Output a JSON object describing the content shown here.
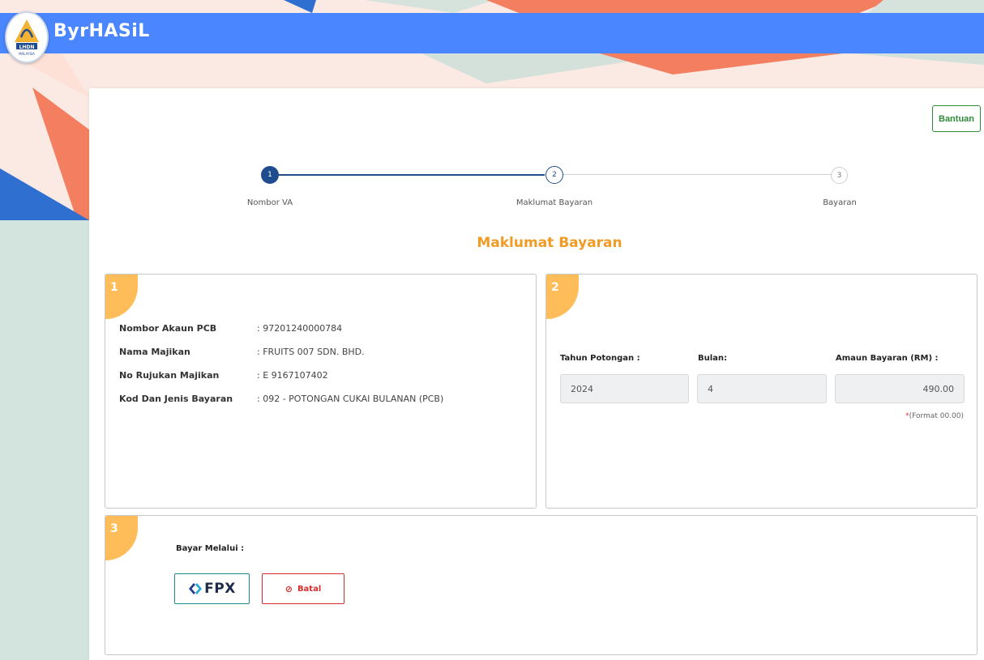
{
  "header": {
    "brand": "ByrHASiL",
    "logo_text_top": "LHDN",
    "logo_text_bottom": "MALAYSIA"
  },
  "help_button": "Bantuan",
  "stepper": {
    "steps": [
      {
        "number": "1",
        "label": "Nombor VA",
        "state": "done"
      },
      {
        "number": "2",
        "label": "Maklumat Bayaran",
        "state": "current"
      },
      {
        "number": "3",
        "label": "Bayaran",
        "state": "pending"
      }
    ]
  },
  "page_title": "Maklumat Bayaran",
  "section1": {
    "number": "1",
    "rows": [
      {
        "key": "Nombor Akaun PCB",
        "value": ":  97201240000784"
      },
      {
        "key": "Nama Majikan",
        "value": ":  FRUITS 007 SDN. BHD."
      },
      {
        "key": "No Rujukan Majikan",
        "value": ":  E  9167107402"
      },
      {
        "key": "Kod Dan Jenis Bayaran",
        "value": ":   092 - POTONGAN CUKAI BULANAN (PCB)"
      }
    ]
  },
  "section2": {
    "number": "2",
    "year_label": "Tahun Potongan :",
    "year_value": "2024",
    "month_label": "Bulan:",
    "month_value": "4",
    "amount_label": "Amaun Bayaran (RM) :",
    "amount_value": "490.00",
    "format_hint_star": "*",
    "format_hint": "(Format 00.00)"
  },
  "section3": {
    "number": "3",
    "pay_via_label": "Bayar Melalui   :",
    "fpx_label": "FPX",
    "cancel_icon": "⊘",
    "cancel_label": "Batal"
  },
  "colors": {
    "header_blue": "#4a86ff",
    "step_active": "#1f4c8f",
    "title_orange": "#f19a24",
    "corner_orange": "#ffbd59",
    "help_green": "#2e8b3a",
    "cancel_red": "#d62c2c"
  }
}
